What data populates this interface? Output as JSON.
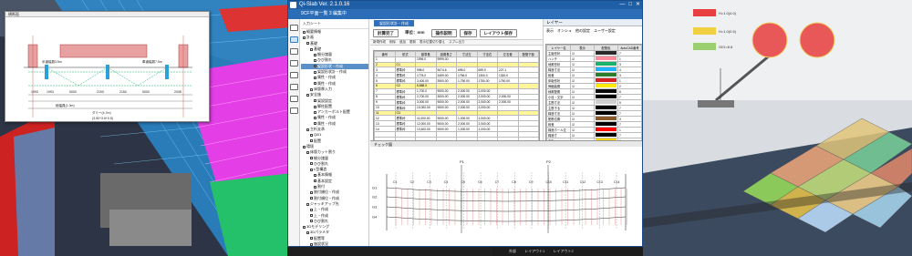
{
  "app": {
    "title": "Qi-Slab Ver. 2.1.0.16",
    "subtitle": "9CF平面一覧 3 編集中",
    "window_controls": [
      "—",
      "□",
      "✕"
    ]
  },
  "tree": {
    "header": "入力シート",
    "items": [
      {
        "label": "概要情報",
        "level": 1,
        "selected": false
      },
      {
        "label": "計画",
        "level": 1,
        "selected": false
      },
      {
        "label": "基礎",
        "level": 2,
        "selected": false
      },
      {
        "label": "基礎",
        "level": 3,
        "selected": false
      },
      {
        "label": "細分諸量",
        "level": 4,
        "selected": false
      },
      {
        "label": "ひび割れ",
        "level": 4,
        "selected": false
      },
      {
        "label": "架設形状・作成",
        "level": 4,
        "selected": true
      },
      {
        "label": "架設形状計・作成",
        "level": 4,
        "selected": false
      },
      {
        "label": "属性・作成",
        "level": 4,
        "selected": false
      },
      {
        "label": "属性・作成",
        "level": 4,
        "selected": false
      },
      {
        "label": "床版厚入力",
        "level": 3,
        "selected": false
      },
      {
        "label": "安全施",
        "level": 2,
        "selected": false
      },
      {
        "label": "架設設定",
        "level": 4,
        "selected": false
      },
      {
        "label": "脚柱配置",
        "level": 4,
        "selected": false
      },
      {
        "label": "アンカーボルト配置",
        "level": 4,
        "selected": false
      },
      {
        "label": "属性・作成",
        "level": 4,
        "selected": false
      },
      {
        "label": "属性・作成",
        "level": 4,
        "selected": false
      },
      {
        "label": "主桁支承",
        "level": 2,
        "selected": false
      },
      {
        "label": "Qi01",
        "level": 3,
        "selected": false
      },
      {
        "label": "配置",
        "level": 3,
        "selected": false
      },
      {
        "label": "環境",
        "level": 1,
        "selected": false
      },
      {
        "label": "床版カット割り",
        "level": 2,
        "selected": false
      },
      {
        "label": "細分諸量",
        "level": 3,
        "selected": false
      },
      {
        "label": "ひび割れ",
        "level": 3,
        "selected": false
      },
      {
        "label": "L型構造",
        "level": 3,
        "selected": false
      },
      {
        "label": "基本情報",
        "level": 4,
        "selected": false
      },
      {
        "label": "基本設定",
        "level": 4,
        "selected": false
      },
      {
        "label": "割付",
        "level": 4,
        "selected": false
      },
      {
        "label": "割付順位・作成",
        "level": 3,
        "selected": false
      },
      {
        "label": "割付順位・作成",
        "level": 3,
        "selected": false
      },
      {
        "label": "ジャッキアップ先",
        "level": 2,
        "selected": false
      },
      {
        "label": "上・作成",
        "level": 3,
        "selected": false
      },
      {
        "label": "上・作成",
        "level": 3,
        "selected": false
      },
      {
        "label": "ひび割れ",
        "level": 3,
        "selected": false
      },
      {
        "label": "3Dモデリング",
        "level": 1,
        "selected": false
      },
      {
        "label": "3Dパラメタ",
        "level": 2,
        "selected": false
      },
      {
        "label": "配置等",
        "level": 3,
        "selected": false
      },
      {
        "label": "施設状況",
        "level": 3,
        "selected": false
      },
      {
        "label": "構造確認",
        "level": 3,
        "selected": false
      }
    ]
  },
  "main": {
    "tab": "架設形状計・作成",
    "buttons": [
      "計算完了",
      "単位：mm",
      "操作説明",
      "保存",
      "レイアウト保存"
    ],
    "toolbar": [
      "新規作成",
      "削除",
      "追加",
      "更新",
      "表示位置切り替え",
      "スプレ出力"
    ],
    "table_headers": [
      "番号",
      "形式",
      "基準長",
      "設置長さ",
      "寸法左",
      "寸法右",
      "左右差",
      "配筋下部"
    ],
    "rows": [
      {
        "c": [
          "1",
          "",
          "1996.0",
          "9999.00",
          "",
          "",
          "",
          ""
        ],
        "cls": ""
      },
      {
        "c": [
          "2",
          "G1",
          "",
          "",
          "",
          "",
          "",
          ""
        ],
        "cls": "yellow"
      },
      {
        "c": [
          "3",
          "標準枠",
          "998.0",
          "9074.6",
          "695.0",
          "699.0",
          "227.1",
          ""
        ],
        "cls": ""
      },
      {
        "c": [
          "4",
          "標準枠",
          "1778.0",
          "3499.00",
          "1756.0",
          "1300.0",
          "1300.0",
          ""
        ],
        "cls": ""
      },
      {
        "c": [
          "5",
          "標準枠",
          "3,400.00",
          "3900.00",
          "1,750.00",
          "1750.00",
          "1750.00",
          ""
        ],
        "cls": ""
      },
      {
        "c": [
          "6",
          "G2",
          "8,888.0",
          "",
          "",
          "",
          "",
          ""
        ],
        "cls": "yellow"
      },
      {
        "c": [
          "7",
          "標準枠",
          "1,700.0",
          "9000.00",
          "2,000.00",
          "2,000.00",
          "",
          ""
        ],
        "cls": ""
      },
      {
        "c": [
          "8",
          "標準枠",
          "2,700.00",
          "3000.00",
          "2,000.00",
          "2,000.00",
          "2,000.00",
          ""
        ],
        "cls": ""
      },
      {
        "c": [
          "9",
          "標準枠",
          "3,000.00",
          "9000.00",
          "2,000.00",
          "2,000.00",
          "2,000.00",
          ""
        ],
        "cls": ""
      },
      {
        "c": [
          "10",
          "標準枠",
          "10,000.00",
          "9000.00",
          "2,000.00",
          "2,000.00",
          "",
          ""
        ],
        "cls": ""
      },
      {
        "c": [
          "11",
          "G3",
          "",
          "",
          "",
          "",
          "",
          ""
        ],
        "cls": "yellow"
      },
      {
        "c": [
          "12",
          "標準枠",
          "11,000.00",
          "9000.00",
          "1,000.00",
          "1,000.00",
          "",
          ""
        ],
        "cls": ""
      },
      {
        "c": [
          "13",
          "標準枠",
          "12,000.00",
          "9000.00",
          "2,000.00",
          "2,000.00",
          "",
          ""
        ],
        "cls": ""
      },
      {
        "c": [
          "14",
          "標準枠",
          "13,400.00",
          "9000.00",
          "1,000.00",
          "1,000.00",
          "",
          ""
        ],
        "cls": ""
      },
      {
        "c": [
          "",
          "",
          "",
          "",
          "",
          "",
          "",
          ""
        ],
        "cls": ""
      },
      {
        "c": [
          "",
          "",
          "",
          "",
          "",
          "",
          "",
          ""
        ],
        "cls": ""
      },
      {
        "c": [
          "",
          "",
          "",
          "",
          "",
          "",
          "",
          ""
        ],
        "cls": ""
      },
      {
        "c": [
          "",
          "",
          "",
          "",
          "",
          "",
          "",
          ""
        ],
        "cls": ""
      },
      {
        "c": [
          "",
          "",
          "",
          "",
          "",
          "",
          "",
          ""
        ],
        "cls": ""
      },
      {
        "c": [
          "",
          "",
          "",
          "",
          "",
          "",
          "",
          ""
        ],
        "cls": ""
      }
    ],
    "chart_title": "チェック図",
    "chart_labels": {
      "g": [
        "G1",
        "G2",
        "G3",
        "G4"
      ],
      "top": [
        "P1",
        "P2"
      ],
      "c": [
        "C1",
        "C2",
        "C3",
        "C4",
        "C5",
        "C6",
        "C7",
        "C8",
        "C9",
        "C10",
        "C11",
        "C12",
        "C13",
        "C14"
      ]
    }
  },
  "layer_panel": {
    "title": "レイヤー",
    "radios": [
      "表示",
      "オンシュ",
      "他の設定",
      "ユーザー設定"
    ],
    "headers": [
      "レイヤー名",
      "表示",
      "配筋色",
      "AutoCAD番号"
    ],
    "rows": [
      {
        "name": "主版形状",
        "color": "#2a2a2a",
        "num": "7"
      },
      {
        "name": "ハンチ",
        "color": "#ff8c9a",
        "num": "1"
      },
      {
        "name": "地覆形状",
        "color": "#19b26b",
        "num": "3"
      },
      {
        "name": "構造寸法",
        "color": "#1fb3ff",
        "num": "4"
      },
      {
        "name": "段差",
        "color": "#2c7c2c",
        "num": "3"
      },
      {
        "name": "床版形状",
        "color": "#d82020",
        "num": "1"
      },
      {
        "name": "伸縮装置",
        "color": "#ffea00",
        "num": "2"
      },
      {
        "name": "地覆配置",
        "color": "#0a0a0a",
        "num": "8"
      },
      {
        "name": "小径・文字",
        "color": "#000000",
        "num": "7"
      },
      {
        "name": "主筋寸法",
        "color": "#d0d0d0",
        "num": "9"
      },
      {
        "name": "主筋下る",
        "color": "#000000",
        "num": "7"
      },
      {
        "name": "構造寸法",
        "color": "#000000",
        "num": "7"
      },
      {
        "name": "配筋位置",
        "color": "#8b5a2b",
        "num": "4"
      },
      {
        "name": "段差",
        "color": "#000000",
        "num": "7"
      },
      {
        "name": "構造ホール位",
        "color": "#ff0000",
        "num": "1"
      },
      {
        "name": "構造寸",
        "color": "#000000",
        "num": "7"
      },
      {
        "name": "主版",
        "color": "#ffd700",
        "num": "2"
      },
      {
        "name": "ブラケット",
        "color": "#000000",
        "num": "7"
      }
    ]
  },
  "section_window": {
    "title": "横断面",
    "dims": [
      "1993",
      "1993",
      "5000",
      "2150",
      "2150",
      "5000",
      "2008"
    ],
    "labels": [
      "歩道幅員3.5m",
      "車道幅員7.5m",
      "総幅員(1.0m)",
      "ダミー(4.7m)",
      "(3.50+3.6+0.5)"
    ]
  },
  "bottom_bar": {
    "tabs": [
      "外部",
      "レイアウト1",
      "レイアウト2"
    ]
  },
  "top_strip": {
    "value": "95,461.87"
  },
  "right_view": {
    "labels": [
      "H=1.0(4.0)",
      "H=1.0(0.5)",
      "GIG=8.8"
    ]
  },
  "colors": {
    "accent": "#1f5fa6",
    "selected": "#5b8fc7",
    "highlight": "#fff69a"
  }
}
